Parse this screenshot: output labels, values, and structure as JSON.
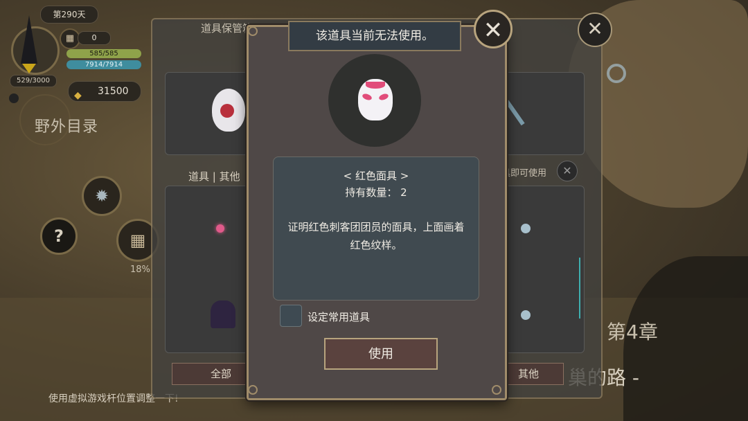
{
  "hud": {
    "day": "第290天",
    "counter": "0",
    "xp": "529/3000",
    "hp": "585/585",
    "mp": "7914/7914",
    "gold": "31500",
    "field_directory": "野外目录",
    "progress_percent": "18%"
  },
  "hint": "使用虚拟游戏杆位置调整一下!",
  "chapter": {
    "title": "第4章",
    "subtitle": "巢的路 -"
  },
  "storage": {
    "title": "道具保管箱",
    "tabs_label": "道具 | 其他",
    "usable_label": "具即可使用",
    "filter_all": "全部",
    "filter_other": "其他"
  },
  "modal": {
    "message": "该道具当前无法使用。",
    "item_name": "< 红色面具 >",
    "item_quantity": "持有数量： 2",
    "item_description": "证明红色刺客团团员的面具，上面画着红色纹样。",
    "favorite_label": "设定常用道具",
    "use_button": "使用"
  },
  "icons": {
    "close": "close-icon",
    "gear": "gear-icon",
    "help": "help-icon",
    "calendar": "calendar-icon",
    "gold": "gold-icon",
    "mask": "red-mask-icon"
  },
  "colors": {
    "hp_bar": "#8fa34a",
    "mp_bar": "#3f8d9e",
    "mask_accent": "#e14c7a",
    "frame_gold": "#a08c6a"
  }
}
